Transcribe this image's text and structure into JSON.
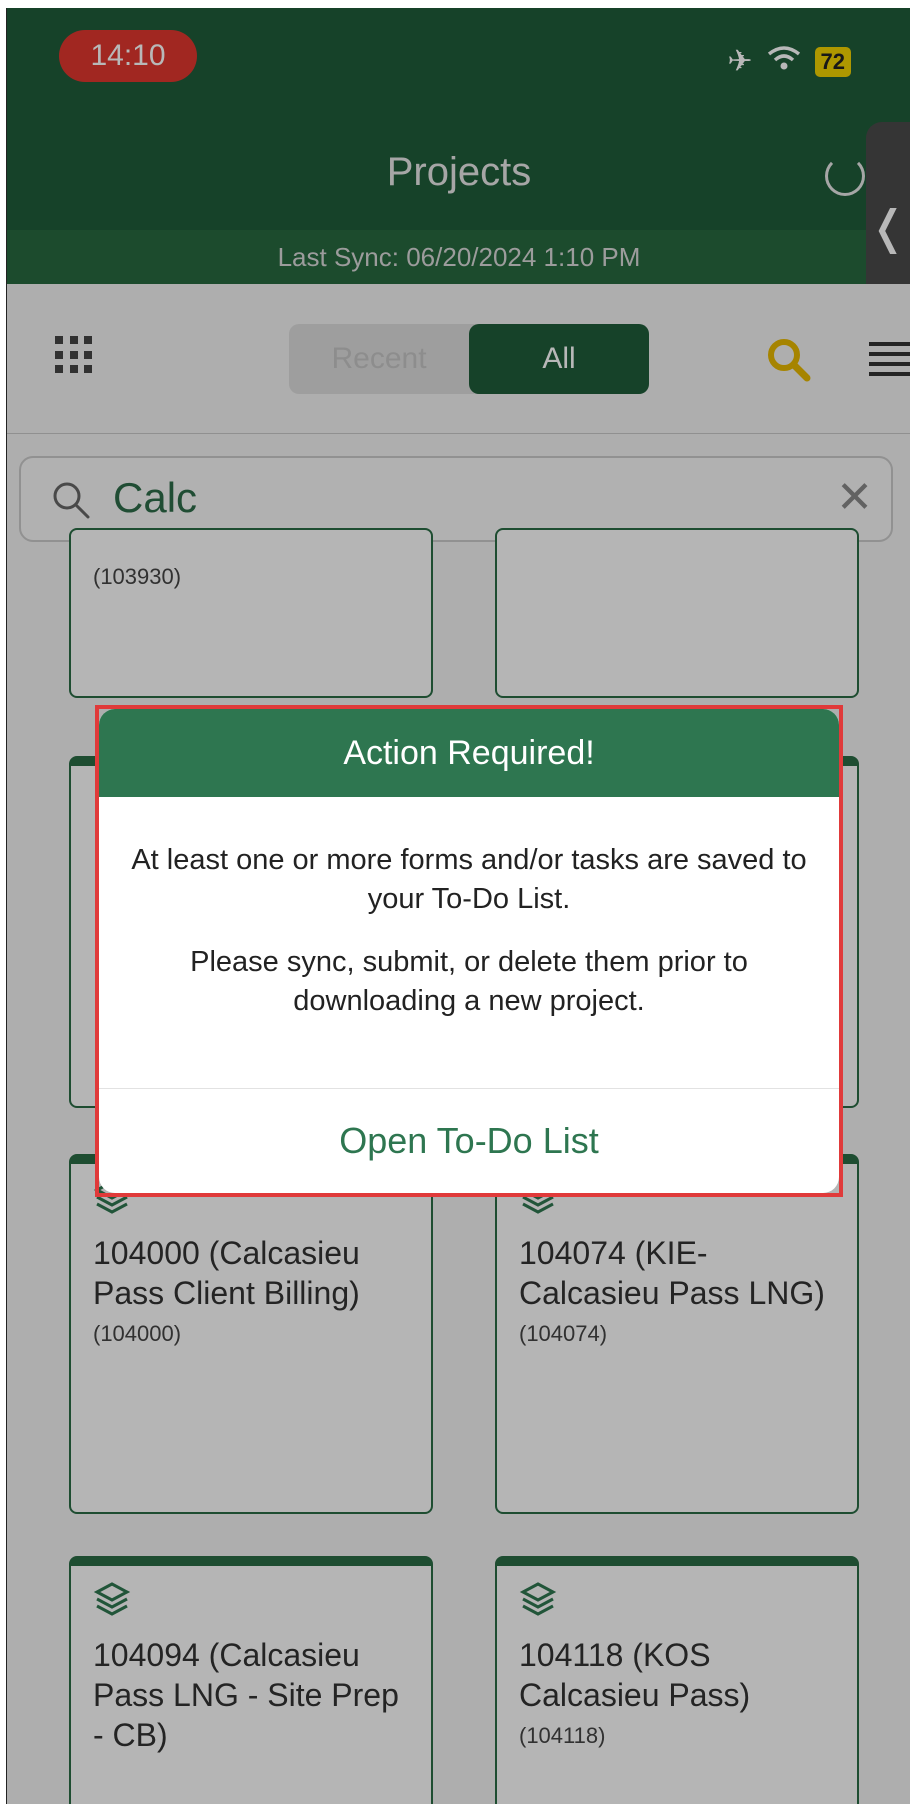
{
  "status_bar": {
    "time": "14:10",
    "battery": "72"
  },
  "header": {
    "title": "Projects",
    "last_sync": "Last Sync: 06/20/2024 1:10 PM"
  },
  "toolbar": {
    "tabs": [
      "Recent",
      "All"
    ],
    "active_tab": "All"
  },
  "search": {
    "value": "Calc"
  },
  "cards": [
    {
      "name": "",
      "code": "(103930)"
    },
    {
      "name": "",
      "code": ""
    },
    {
      "name": "104000 (Calcasieu Pass Client Billing)",
      "code": "(104000)"
    },
    {
      "name": "104074 (KIE-Calcasieu Pass LNG)",
      "code": "(104074)"
    },
    {
      "name": "104094 (Calcasieu Pass LNG - Site Prep - CB)",
      "code": ""
    },
    {
      "name": "104118 (KOS Calcasieu Pass)",
      "code": "(104118)"
    }
  ],
  "modal": {
    "title": "Action Required!",
    "message1": "At least one or more forms and/or tasks are saved to your To-Do List.",
    "message2": "Please sync, submit, or delete them prior to downloading a new project.",
    "action": "Open To-Do List"
  },
  "colors": {
    "primary": "#1f5c3a",
    "accent": "#2e7650",
    "search_icon": "#e6b800",
    "highlight": "#e03a3a"
  }
}
